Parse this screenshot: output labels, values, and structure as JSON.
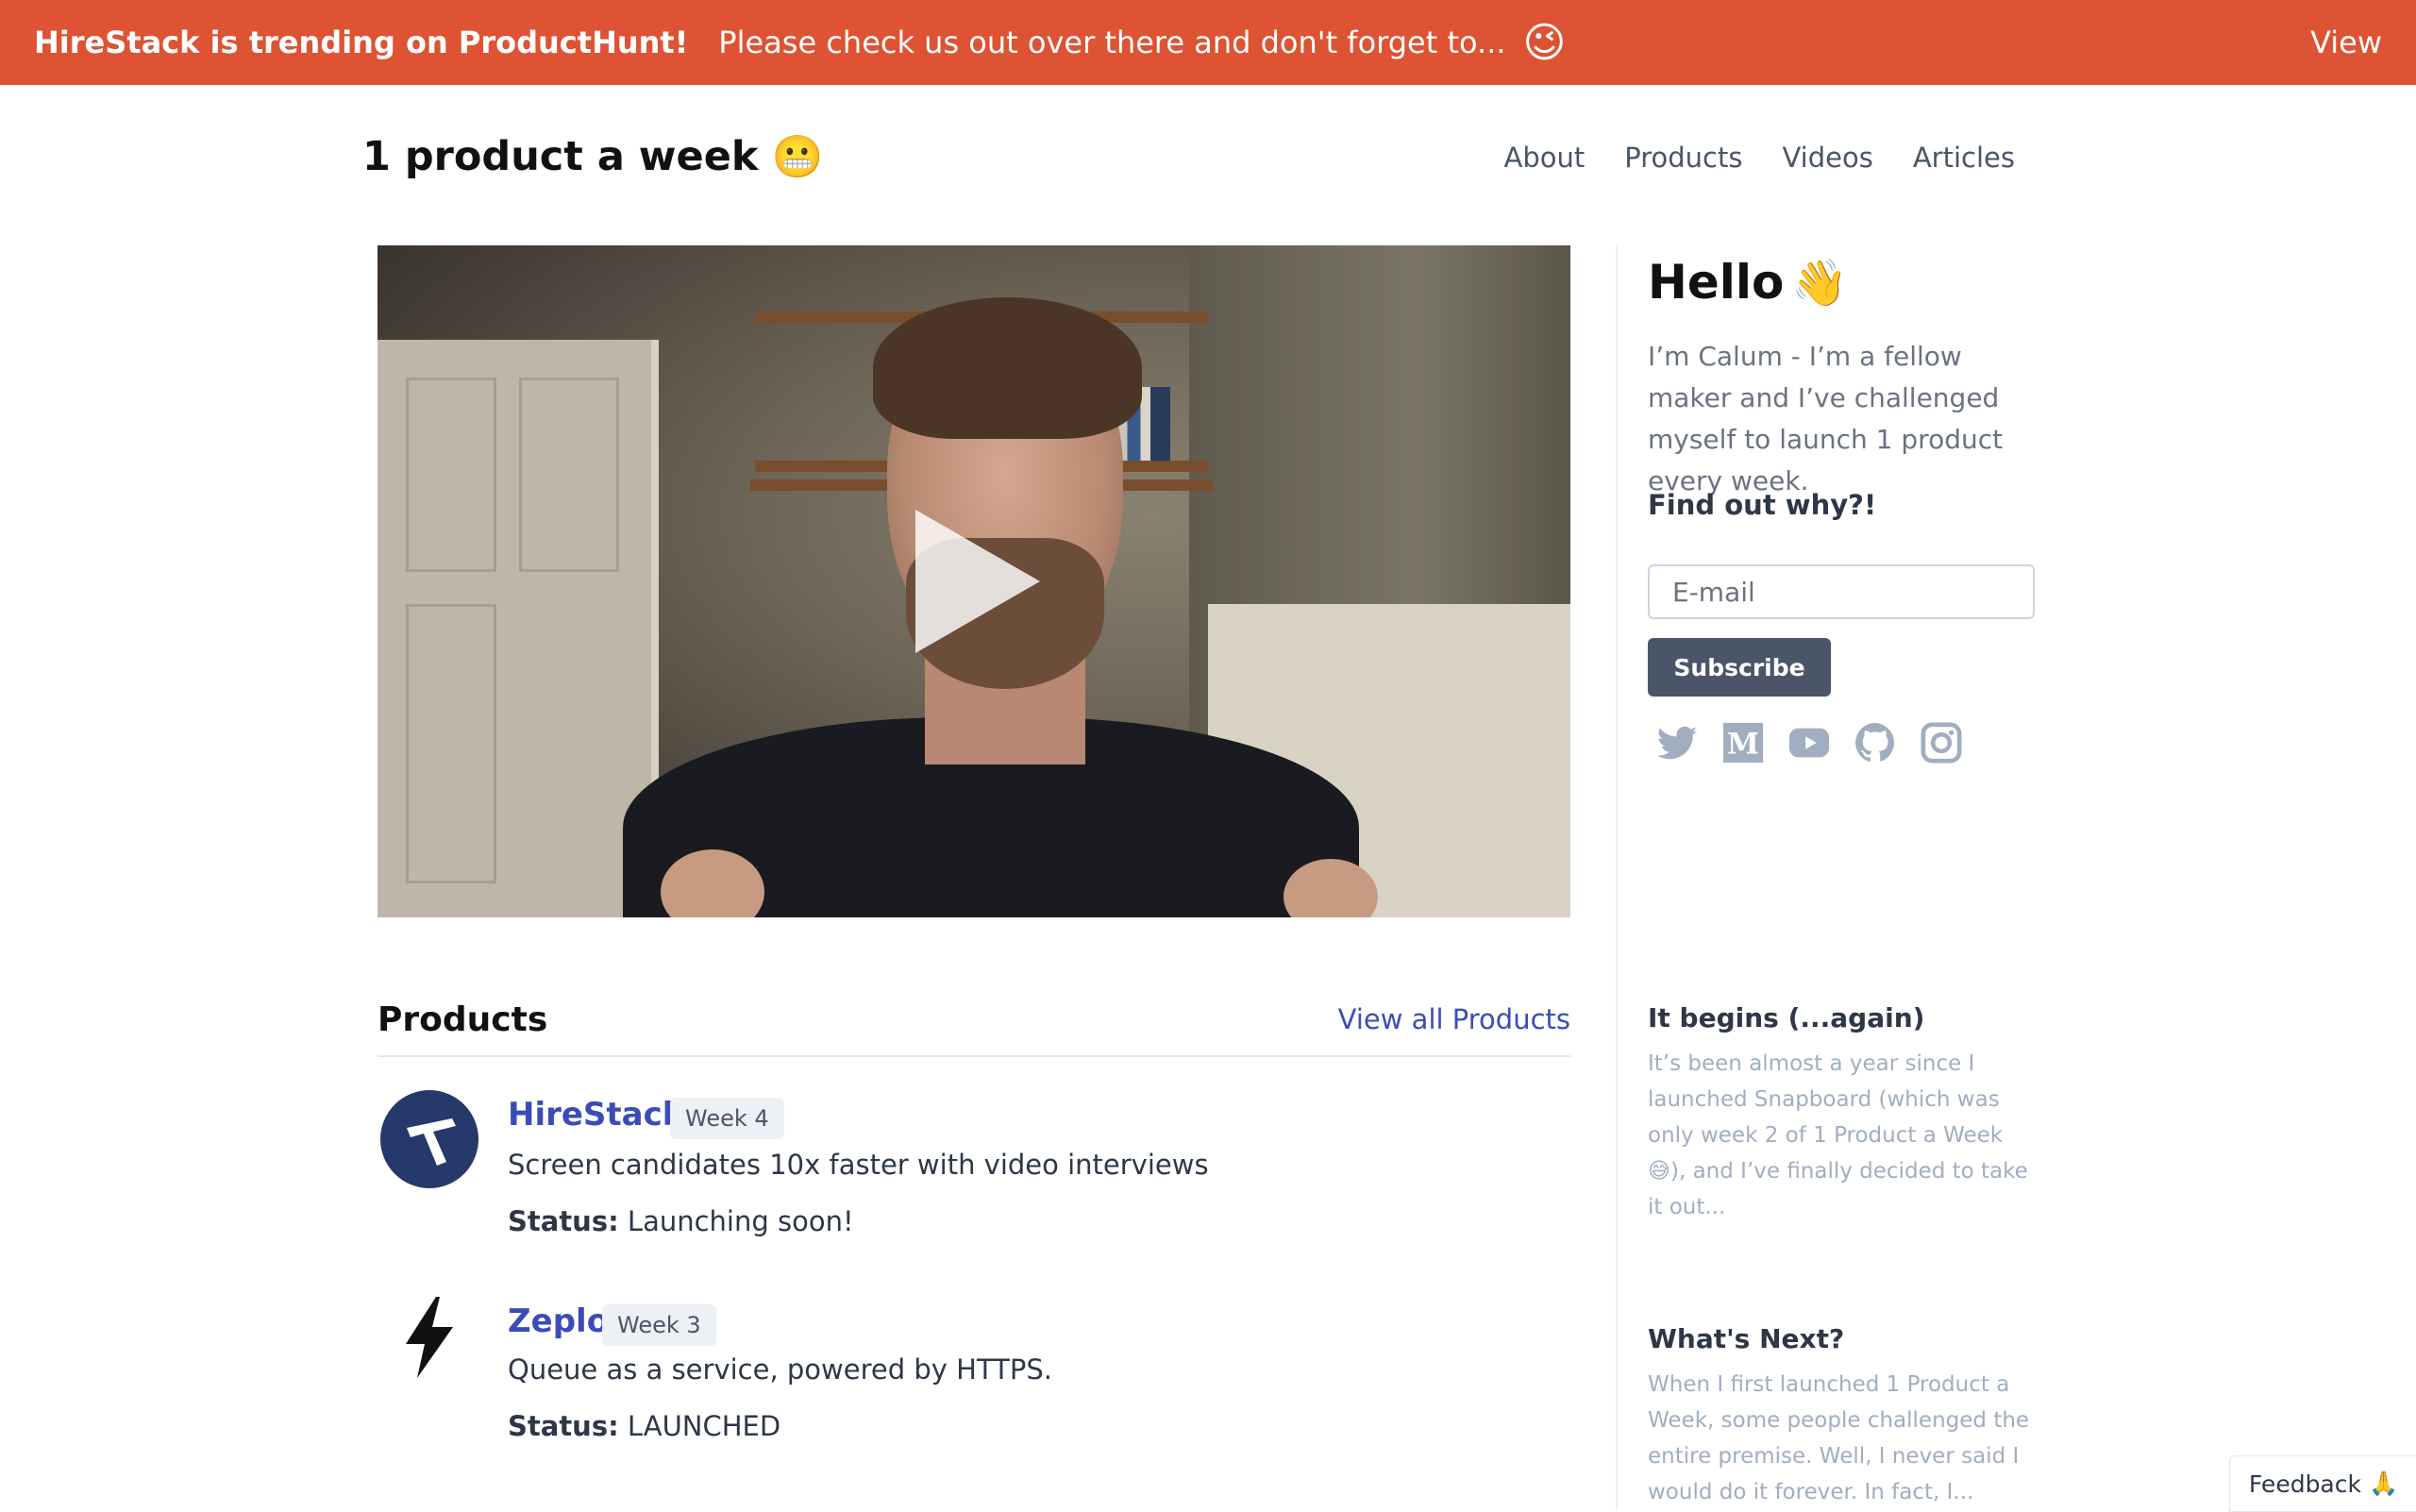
{
  "banner": {
    "headline": "HireStack is trending on ProductHunt!",
    "message": "Please check us out over there and don't forget to...",
    "emoji": "😉",
    "view_label": "View",
    "color": "#dd5333"
  },
  "header": {
    "title": "1 product a week",
    "title_emoji": "😬",
    "nav": [
      "About",
      "Products",
      "Videos",
      "Articles"
    ]
  },
  "video": {
    "icon": "play-icon"
  },
  "products": {
    "heading": "Products",
    "view_all": "View all Products",
    "items": [
      {
        "name": "HireStack",
        "week": "Week 4",
        "description": "Screen candidates 10x faster with video interviews",
        "status_label": "Status:",
        "status": "Launching soon!",
        "logo": "hirestack-logo"
      },
      {
        "name": "Zeplo",
        "week": "Week 3",
        "description": "Queue as a service, powered by HTTPS.",
        "status_label": "Status:",
        "status": "LAUNCHED",
        "logo": "lightning-bolt-icon"
      }
    ]
  },
  "sidebar": {
    "hello": "Hello",
    "hello_emoji": "👋",
    "intro": "I’m Calum - I’m a fellow maker and I’ve challenged myself to launch 1 product every week.",
    "find_out": "Find out why?!",
    "email_placeholder": "E-mail",
    "subscribe_label": "Subscribe",
    "socials": [
      "twitter-icon",
      "medium-icon",
      "youtube-icon",
      "github-icon",
      "instagram-icon"
    ],
    "articles": [
      {
        "title": "It begins (...again)",
        "excerpt": "It’s been almost a year since I launched Snapboard (which was only week 2 of 1 Product a Week 😅), and I’ve finally decided to take it out..."
      },
      {
        "title": "What's Next?",
        "excerpt": "When I first launched 1 Product a Week, some people challenged the entire premise. Well, I never said I would do it forever. In fact, I..."
      }
    ]
  },
  "feedback": {
    "label": "Feedback",
    "emoji": "🙏"
  }
}
